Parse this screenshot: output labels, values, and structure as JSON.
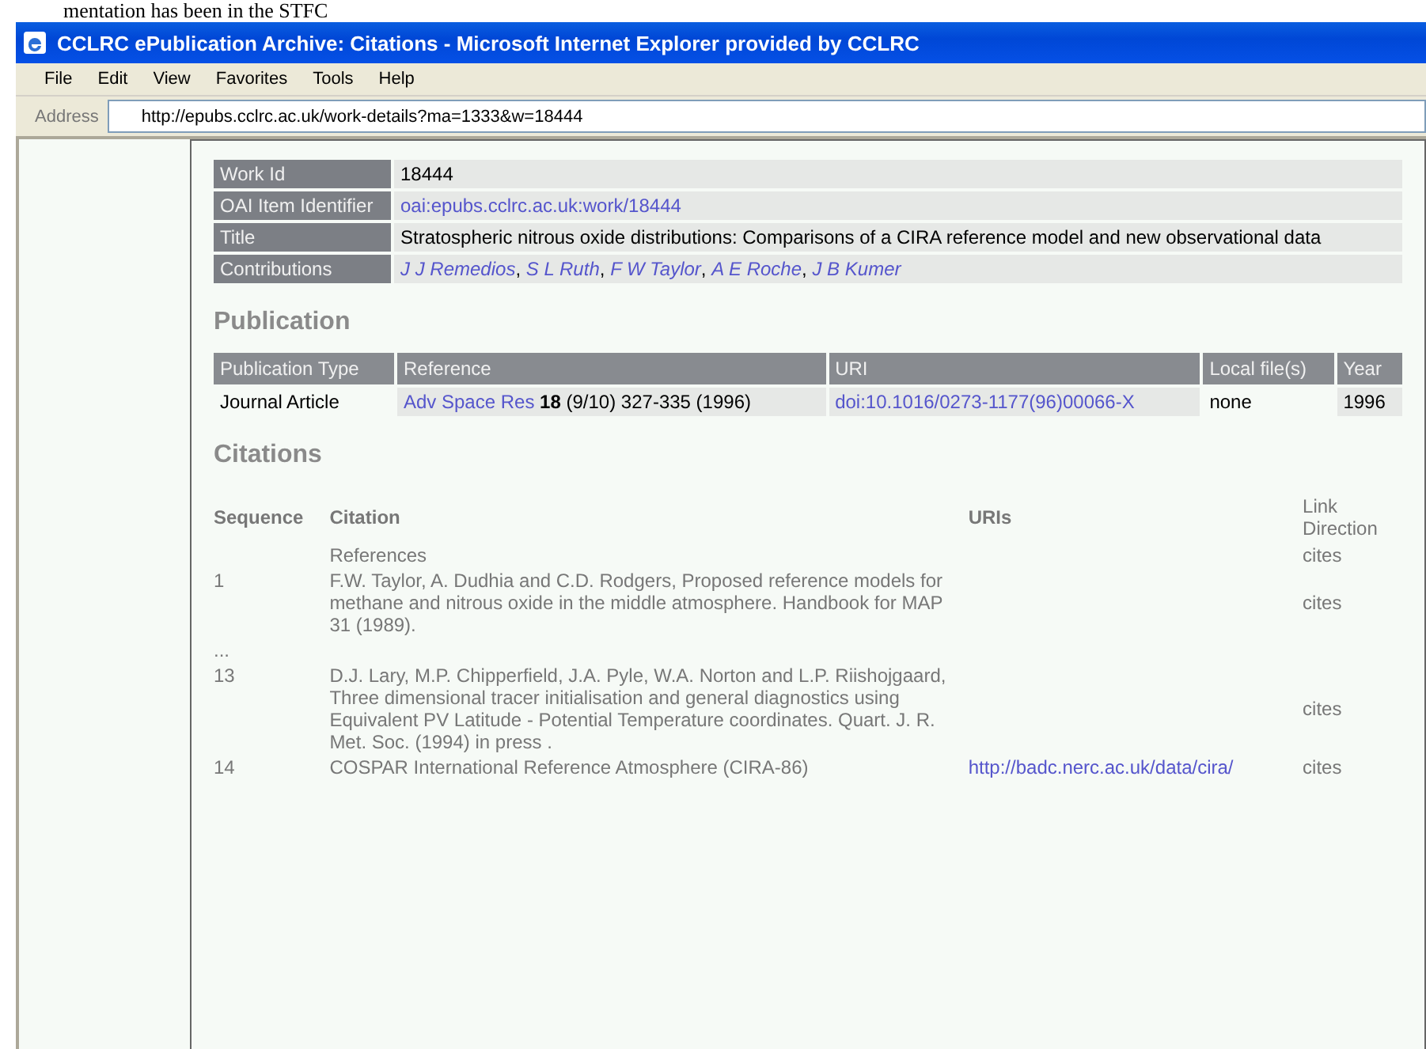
{
  "document_text": "mentation has been in the STFC",
  "window": {
    "title": "CCLRC ePublication Archive: Citations - Microsoft Internet Explorer provided by CCLRC"
  },
  "menu": [
    "File",
    "Edit",
    "View",
    "Favorites",
    "Tools",
    "Help"
  ],
  "address_bar": {
    "label": "Address",
    "value": "http://epubs.cclrc.ac.uk/work-details?ma=1333&w=18444"
  },
  "details": [
    {
      "label": "Work Id",
      "kind": "text",
      "value": "18444"
    },
    {
      "label": "OAI Item Identifier",
      "kind": "link",
      "value": "oai:epubs.cclrc.ac.uk:work/18444"
    },
    {
      "label": "Title",
      "kind": "text",
      "value": "Stratospheric nitrous oxide distributions: Comparisons of a CIRA reference model and new observational data"
    },
    {
      "label": "Contributions",
      "kind": "links",
      "separator": ",",
      "links": [
        "J J Remedios",
        "S L Ruth",
        "F W Taylor",
        "A E Roche",
        "J B Kumer"
      ]
    }
  ],
  "publication": {
    "heading": "Publication",
    "columns": [
      "Publication Type",
      "Reference",
      "URI",
      "Local file(s)",
      "Year"
    ],
    "rows": [
      {
        "type": "Journal Article",
        "reference_link": "Adv Space Res",
        "reference_rest": "**18** (9/10) 327-335 (1996)",
        "uri": "doi:10.1016/0273-1177(96)00066-X",
        "local_files": "none",
        "year": "1996"
      }
    ]
  },
  "citations": {
    "heading": "Citations",
    "columns": [
      "Sequence",
      "Citation",
      "URIs",
      "Link Direction"
    ],
    "rows": [
      {
        "sequence": "",
        "citation": "References",
        "uri": "",
        "direction": "cites"
      },
      {
        "sequence": "1",
        "citation": "F.W. Taylor, A. Dudhia and C.D. Rodgers, Proposed reference models for methane and nitrous oxide in the middle atmosphere. Handbook for MAP 31 (1989).",
        "uri": "",
        "direction": "cites"
      },
      {
        "sequence": "...",
        "citation": "",
        "uri": "",
        "direction": ""
      },
      {
        "sequence": "13",
        "citation": "D.J. Lary, M.P. Chipperfield, J.A. Pyle, W.A. Norton and L.P. Riishojgaard, Three dimensional tracer initialisation and general diagnostics using Equivalent PV Latitude - Potential Temperature coordinates. Quart. J. R. Met. Soc. (1994) in press .",
        "uri": "",
        "direction": "cites"
      },
      {
        "sequence": "14",
        "citation": "COSPAR International Reference Atmosphere (CIRA-86)",
        "uri": "http://badc.nerc.ac.uk/data/cira/",
        "direction": "cites"
      }
    ]
  }
}
